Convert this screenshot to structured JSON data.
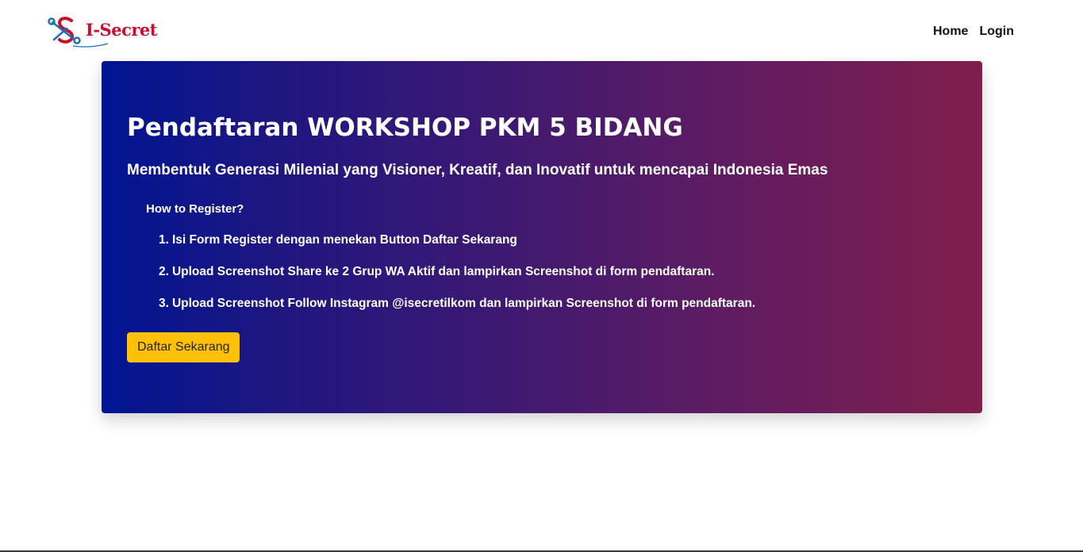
{
  "brand": {
    "name": "I-Secret",
    "logo_icon": "scissors-s-logo-icon",
    "color": "#c8102e"
  },
  "nav": {
    "items": [
      {
        "label": "Home"
      },
      {
        "label": "Login"
      }
    ]
  },
  "hero": {
    "title": "Pendaftaran WORKSHOP PKM 5 BIDANG",
    "subtitle": "Membentuk Generasi Milenial yang Visioner, Kreatif, dan Inovatif untuk mencapai Indonesia Emas",
    "howto_heading": "How to Register?",
    "steps": [
      {
        "num": "1.",
        "text": "Isi Form Register dengan menekan Button Daftar Sekarang"
      },
      {
        "num": "2.",
        "text": "Upload Screenshot Share ke 2 Grup WA Aktif dan lampirkan Screenshot di form pendaftaran."
      },
      {
        "num": "3.",
        "text": "Upload Screenshot Follow Instagram @isecretilkom dan lampirkan Screenshot di form pendaftaran."
      }
    ],
    "cta_label": "Daftar Sekarang",
    "gradient_start": "#001593",
    "gradient_end": "#801e4c",
    "cta_color": "#ffc107"
  }
}
